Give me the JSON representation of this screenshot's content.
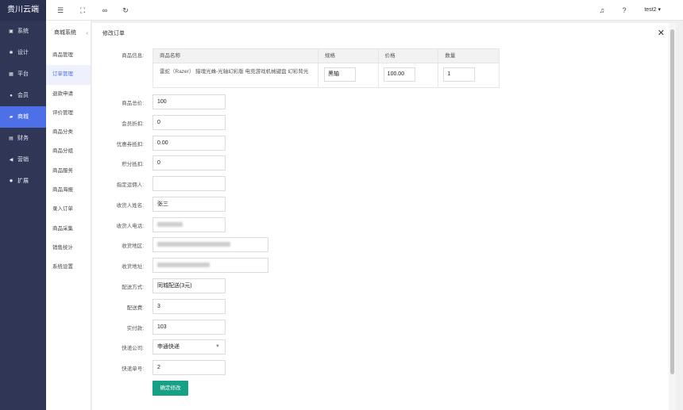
{
  "app": {
    "brand": "贵川云端"
  },
  "nav": [
    {
      "label": "系统",
      "icon": "desktop-icon",
      "glyph": "▣"
    },
    {
      "label": "设计",
      "icon": "puzzle-icon",
      "glyph": "✱"
    },
    {
      "label": "平台",
      "icon": "grid-icon",
      "glyph": "▦"
    },
    {
      "label": "会员",
      "icon": "user-icon",
      "glyph": "●"
    },
    {
      "label": "商城",
      "icon": "shop-icon",
      "glyph": "▰",
      "active": true
    },
    {
      "label": "财务",
      "icon": "wallet-icon",
      "glyph": "▤"
    },
    {
      "label": "营销",
      "icon": "megaphone-icon",
      "glyph": "◀"
    },
    {
      "label": "扩展",
      "icon": "gear-icon",
      "glyph": "✹"
    }
  ],
  "topbar": {
    "user": "test2"
  },
  "subnav": {
    "title": "商城系统",
    "items": [
      "商品管理",
      "订单管理",
      "退款申请",
      "评价管理",
      "商品分类",
      "商品分组",
      "商品服务",
      "商品海报",
      "录入订单",
      "商品采集",
      "销售统计",
      "系统设置"
    ],
    "active_index": 1
  },
  "modal": {
    "title": "修改订单",
    "product_label": "商品信息:",
    "table": {
      "headers": [
        "商品名称",
        "规格",
        "价格",
        "数量"
      ],
      "row": {
        "name": "雷蛇（Razer） 猎魂光蛛-光轴幻彩版 电竞游戏机械键盘 幻彩背光",
        "spec": "黑轴",
        "price": "100.00",
        "qty": "1"
      }
    },
    "fields": {
      "total_price": {
        "label": "商品总价:",
        "value": "100"
      },
      "member_discount": {
        "label": "会员折扣:",
        "value": "0"
      },
      "coupon_discount": {
        "label": "优惠券抵扣:",
        "value": "0.00"
      },
      "points_discount": {
        "label": "积分抵扣:",
        "value": "0"
      },
      "assigned_courier": {
        "label": "指定运佣人:",
        "value": ""
      },
      "receiver_name": {
        "label": "收货人姓名:",
        "value": "张三"
      },
      "receiver_phone": {
        "label": "收货人电话:",
        "value": ""
      },
      "receiver_region": {
        "label": "收货地区:",
        "value": ""
      },
      "receiver_address": {
        "label": "收货地址:",
        "value": ""
      },
      "delivery_method": {
        "label": "配送方式:",
        "value": "同城配送(3元)"
      },
      "delivery_fee": {
        "label": "配送费:",
        "value": "3"
      },
      "paid_amount": {
        "label": "实付款:",
        "value": "103"
      },
      "express_company": {
        "label": "快递公司:",
        "value": "申通快递"
      },
      "tracking_number": {
        "label": "快递单号:",
        "value": "2"
      }
    },
    "submit_label": "确定修改"
  },
  "colors": {
    "sidebar": "#2f3656",
    "accent": "#4d6fe8",
    "submit": "#16a085"
  }
}
